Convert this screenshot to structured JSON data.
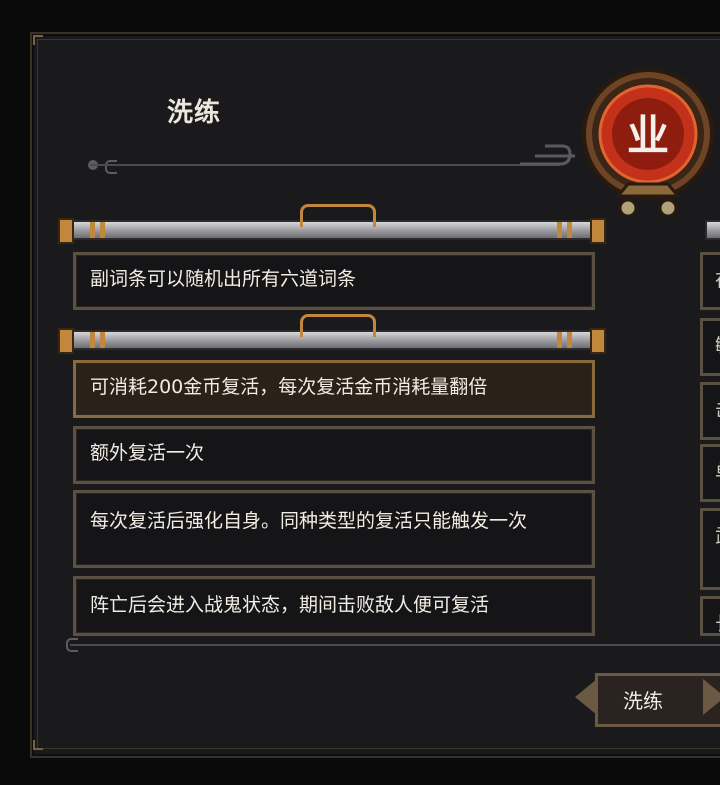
{
  "window": {
    "title": "洗练"
  },
  "badge": {
    "glyph": "业",
    "color_outer": "#7a4b2a",
    "color_inner": "#c4311a"
  },
  "top_entry": {
    "text": "副词条可以随机出所有六道词条"
  },
  "options": [
    {
      "text": "可消耗200金币复活，每次复活金币消耗量翻倍",
      "selected": true
    },
    {
      "text": "额外复活一次",
      "selected": false
    },
    {
      "text": "每次复活后强化自身。同种类型的复活只能触发一次",
      "selected": false
    },
    {
      "text": "阵亡后会进入战鬼状态，期间击败敌人便可复活",
      "selected": false
    }
  ],
  "side_cards": [
    {
      "text": "在"
    },
    {
      "text": "敏"
    },
    {
      "text": "击"
    },
    {
      "text": "单"
    },
    {
      "text": "武"
    },
    {
      "text": "长"
    }
  ],
  "actions": {
    "reroll_label": "洗练"
  }
}
